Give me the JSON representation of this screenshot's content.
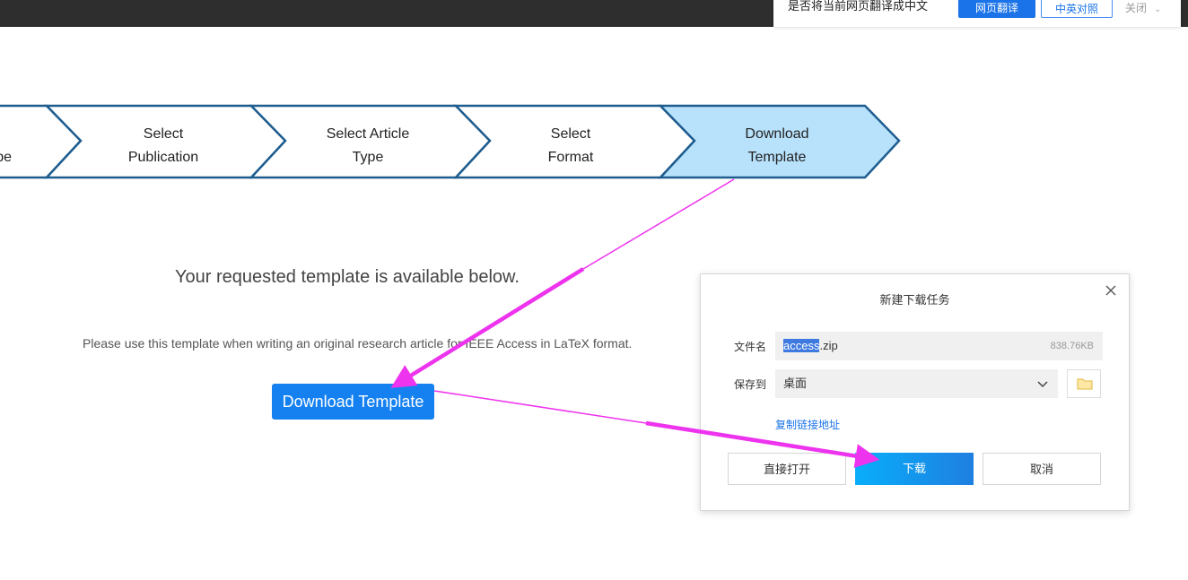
{
  "translate_bar": {
    "prompt": "是否将当前网页翻译成中文",
    "translate_button": "网页翻译",
    "bilingual_button": "中英对照",
    "close_button": "关闭"
  },
  "steps": [
    {
      "label": "pe",
      "state": "done"
    },
    {
      "label": "Select\nPublication",
      "state": "done"
    },
    {
      "label": "Select Article\nType",
      "state": "done"
    },
    {
      "label": "Select\nFormat",
      "state": "done"
    },
    {
      "label": "Download\nTemplate",
      "state": "active"
    }
  ],
  "main": {
    "available_text": "Your requested template is available below.",
    "instruction_text": "Please use this template when writing an original research article for IEEE Access in LaTeX format.",
    "download_button": "Download Template"
  },
  "dialog": {
    "title": "新建下载任务",
    "filename_label": "文件名",
    "filename_selected": "access",
    "filename_ext": ".zip",
    "file_size": "838.76KB",
    "save_to_label": "保存到",
    "save_to_value": "桌面",
    "copy_link": "复制链接地址",
    "open_button": "直接打开",
    "download_button": "下载",
    "cancel_button": "取消"
  },
  "colors": {
    "step_border": "#1f5d8f",
    "step_active_fill": "#b8e2fb",
    "primary_button": "#1581f1",
    "annotation_arrow": "#ee33ee"
  }
}
